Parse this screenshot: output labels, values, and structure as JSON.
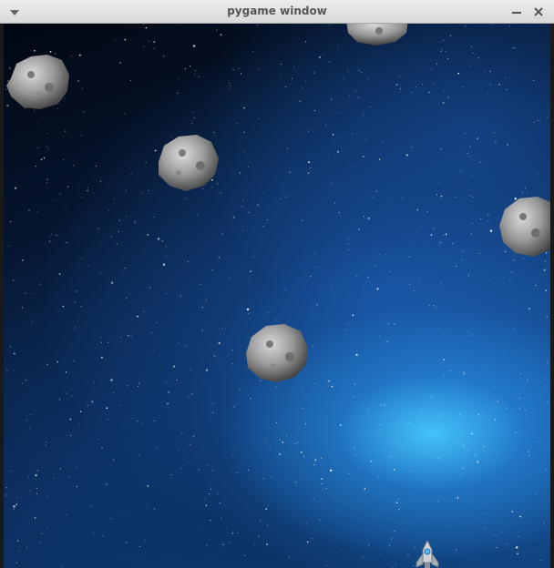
{
  "window": {
    "title": "pygame window"
  },
  "controls": {
    "menu_icon": "chevron-down-icon",
    "minimize_icon": "minimize-icon",
    "close_icon": "close-icon"
  },
  "colors": {
    "titlebar": "#e2e2e2",
    "title_text": "#555555",
    "space_dark": "#020812",
    "nebula_blue": "#46c8ff"
  },
  "game": {
    "asteroid_count": 5,
    "player": "spaceship"
  }
}
